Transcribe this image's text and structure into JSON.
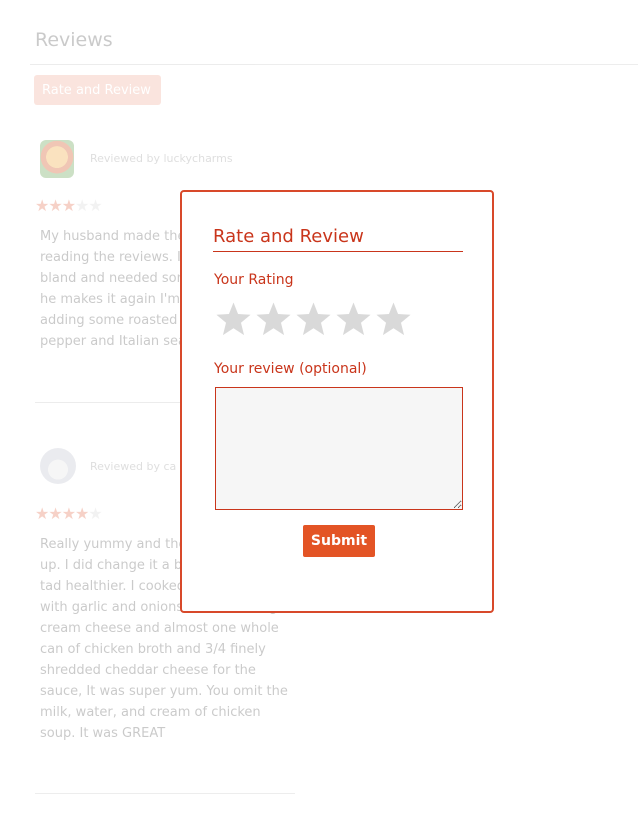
{
  "page": {
    "title": "Reviews",
    "rate_review_button": "Rate and Review"
  },
  "reviews": [
    {
      "reviewer": "Reviewed by luckycharms",
      "rating": 3,
      "max_rating": 5,
      "text_visible": "My husband made the\nreading the reviews. I\nbland and needed son\nhe makes it again I'm\nadding some roasted\npepper and Italian sea"
    },
    {
      "reviewer": "Reviewed by ca",
      "rating": 4,
      "max_rating": 5,
      "text_visible": "Really yummy and the\nup. I did change it a bi\ntad healthier. I cooked\nwith garlic and onions. I used 8oz light\ncream cheese and almost one whole\ncan of chicken broth and 3/4 finely\nshredded cheddar cheese for the\nsauce, It was super yum. You omit the\nmilk, water, and cream of chicken\nsoup. It was GREAT"
    }
  ],
  "modal": {
    "title": "Rate and Review",
    "rating_label": "Your Rating",
    "rating_value": 0,
    "rating_max": 5,
    "review_label": "Your review (optional)",
    "review_value": "",
    "submit_label": "Submit"
  },
  "colors": {
    "accent": "#e35425",
    "modal_text": "#c9351b",
    "star_empty": "#d9d9d9",
    "star_filled_faded": "#e8886e"
  }
}
